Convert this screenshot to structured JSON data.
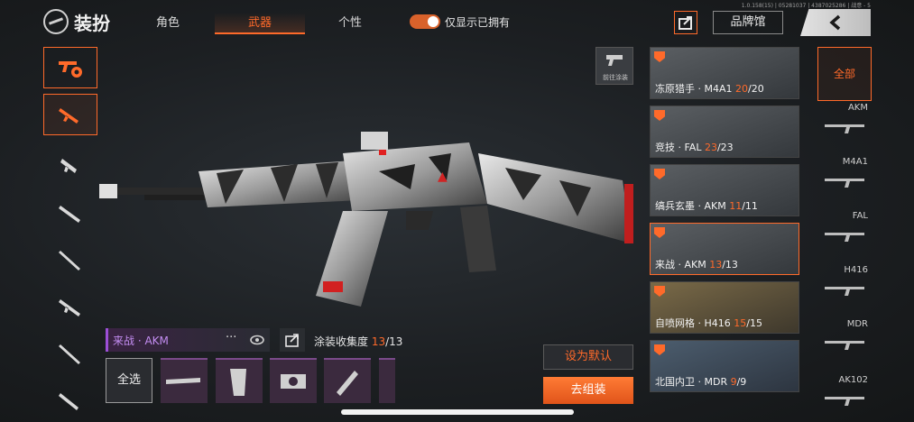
{
  "header": {
    "title": "装扮",
    "tabs": [
      {
        "label": "角色",
        "active": false
      },
      {
        "label": "武器",
        "active": true
      },
      {
        "label": "个性",
        "active": false
      }
    ],
    "toggle_label": "仅显示已拥有",
    "version": "1.0.158(15) | 05281037 | 4387025286 | 战意 - 5",
    "brand_button": "品牌馆"
  },
  "paint_button_label": "前往涂装",
  "skin": {
    "name": "来战 · AKM",
    "more": "···",
    "collection_label": "涂装收集度",
    "collection_current": "13",
    "collection_total": "/13"
  },
  "select_all_label": "全选",
  "actions": {
    "set_default": "设为默认",
    "go_assemble": "去组装"
  },
  "skin_cards": [
    {
      "name": "冻原猎手 · M4A1 ",
      "count": "20",
      "total": "/20",
      "selected": false
    },
    {
      "name": "竞技 · FAL ",
      "count": "23",
      "total": "/23",
      "selected": false
    },
    {
      "name": "缟兵玄墨 · AKM ",
      "count": "11",
      "total": "/11",
      "selected": false
    },
    {
      "name": "来战 · AKM ",
      "count": "13",
      "total": "/13",
      "selected": true
    },
    {
      "name": "自喷网格 · H416 ",
      "count": "15",
      "total": "/15",
      "selected": false
    },
    {
      "name": "北国内卫 · MDR ",
      "count": "9",
      "total": "/9",
      "selected": false
    }
  ],
  "weapon_filter": {
    "all_label": "全部",
    "items": [
      "AKM",
      "M4A1",
      "FAL",
      "H416",
      "MDR",
      "AK102"
    ]
  },
  "colors": {
    "accent": "#ff6a2a",
    "rare_purple": "#c48df2"
  }
}
